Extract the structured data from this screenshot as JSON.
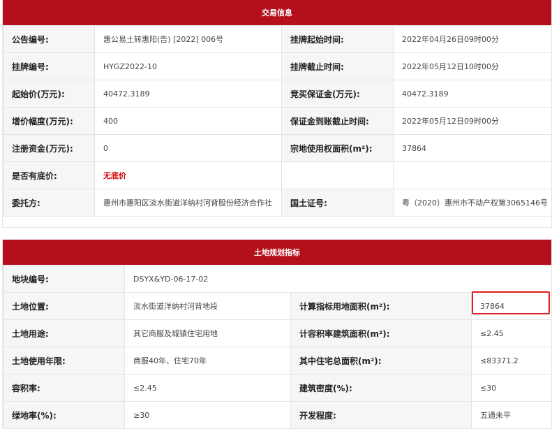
{
  "section1": {
    "title": "交易信息",
    "rows": [
      {
        "l1": "公告编号:",
        "v1": "惠公易土转惠阳(告) [2022] 006号",
        "l2": "挂牌起始时间:",
        "v2": "2022年04月26日09时00分"
      },
      {
        "l1": "挂牌编号:",
        "v1": "HYGZ2022-10",
        "l2": "挂牌截止时间:",
        "v2": "2022年05月12日10时00分"
      },
      {
        "l1": "起始价(万元):",
        "v1": "40472.3189",
        "l2": "竞买保证金(万元):",
        "v2": "40472.3189"
      },
      {
        "l1": "增价幅度(万元):",
        "v1": "400",
        "l2": "保证金到账截止时间:",
        "v2": "2022年05月12日09时00分"
      },
      {
        "l1": "注册资金(万元):",
        "v1": "0",
        "l2": "宗地使用权面积(m²):",
        "v2": "37864"
      },
      {
        "l1": "是否有底价:",
        "v1": "无底价",
        "l2": "",
        "v2": ""
      },
      {
        "l1": "委托方:",
        "v1": "惠州市惠阳区淡水街道洋纳村河背股份经济合作社",
        "l2": "国土证号:",
        "v2": "粤（2020）惠州市不动产权第3065146号"
      }
    ]
  },
  "section2": {
    "title": "土地规划指标",
    "parcel_label": "地块编号:",
    "parcel_value": "DSYX&YD-06-17-02",
    "rows": [
      {
        "l1": "土地位置:",
        "v1": "淡水街道洋纳村河背地段",
        "l2": "计算指标用地面积(m²):",
        "v2": "37864"
      },
      {
        "l1": "土地用途:",
        "v1": "其它商服及城镇住宅用地",
        "l2": "计容积率建筑面积(m²):",
        "v2": "≤2.45"
      },
      {
        "l1": "土地使用年限:",
        "v1": "商服40年、住宅70年",
        "l2": "其中住宅总面积(m²):",
        "v2": "≤83371.2"
      },
      {
        "l1": "容积率:",
        "v1": "≤2.45",
        "l2": "建筑密度(%):",
        "v2": "≤30"
      },
      {
        "l1": "绿地率(%):",
        "v1": "≥30",
        "l2": "开发程度:",
        "v2": "五通未平"
      }
    ]
  }
}
